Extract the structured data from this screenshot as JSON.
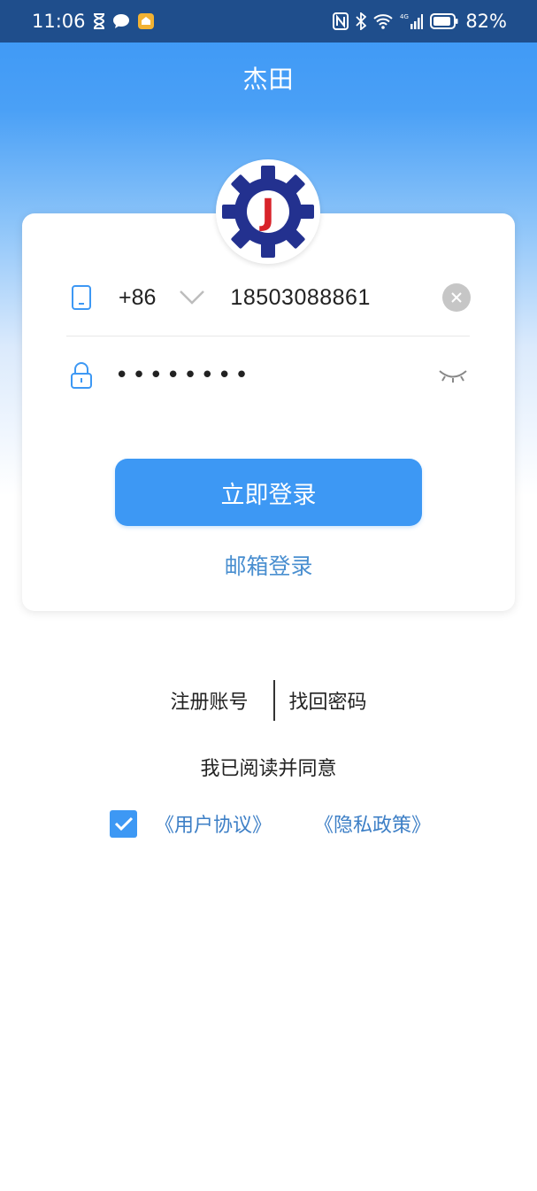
{
  "status_bar": {
    "time": "11:06",
    "battery": "82%",
    "network": "4G"
  },
  "header": {
    "title": "杰田"
  },
  "logo": {
    "letter": "J"
  },
  "form": {
    "country_code": "+86",
    "phone_value": "18503088861",
    "password_value": "••••••••"
  },
  "buttons": {
    "login": "立即登录",
    "email_login": "邮箱登录"
  },
  "links": {
    "register": "注册账号",
    "recover": "找回密码"
  },
  "agreement": {
    "text": "我已阅读并同意",
    "checked": true,
    "user_agreement": "《用户协议》",
    "privacy_policy": "《隐私政策》"
  },
  "colors": {
    "primary": "#3d98f4",
    "status_bar": "#1f4e8c",
    "link": "#3d7fc6",
    "logo_gear": "#23318f",
    "logo_letter": "#d8232a"
  }
}
